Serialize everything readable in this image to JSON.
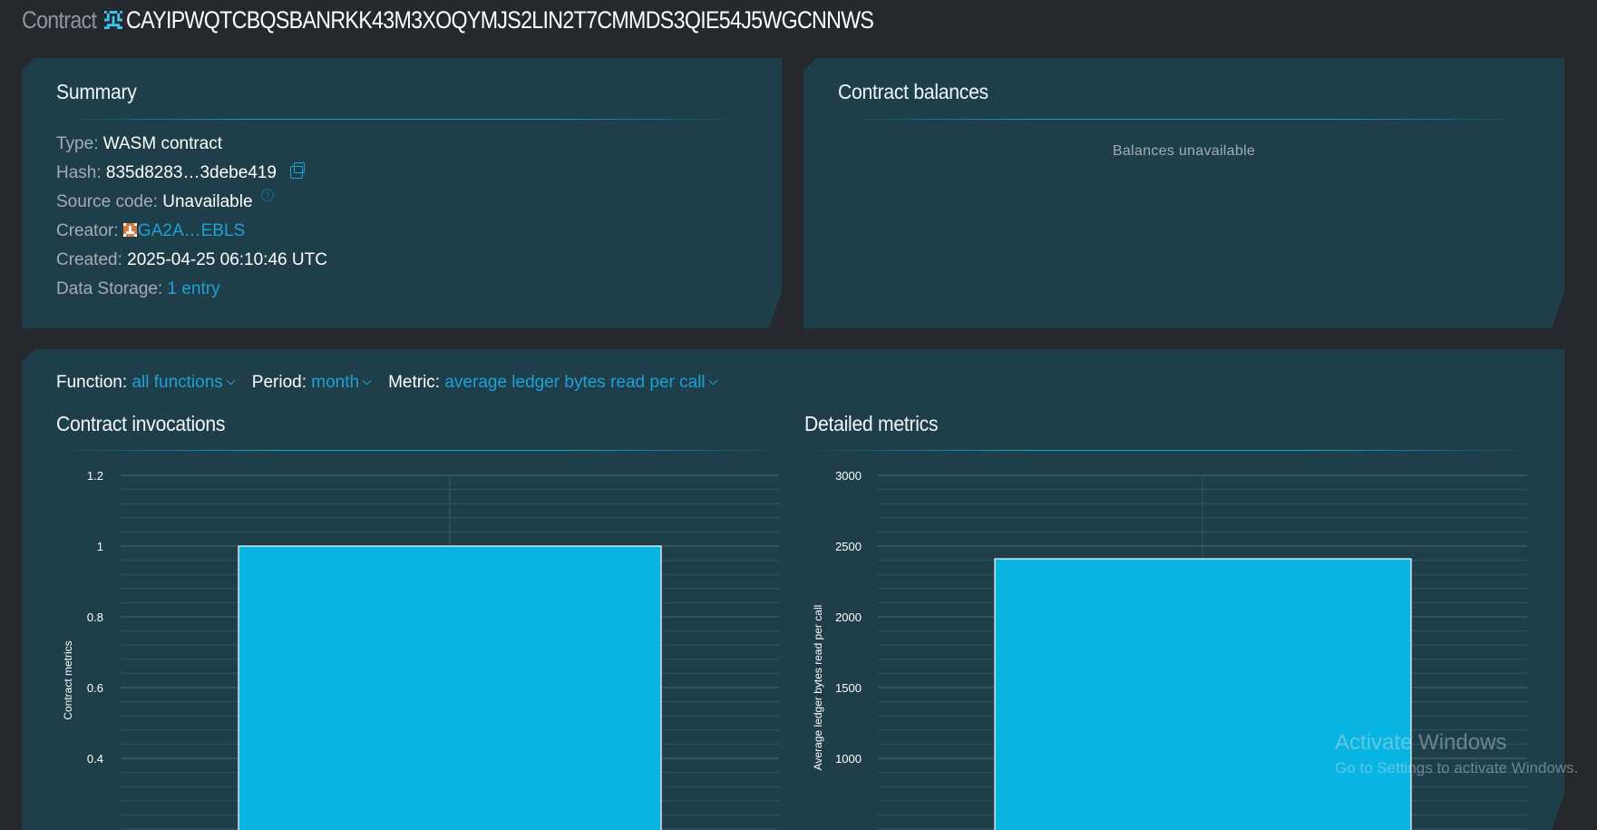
{
  "header": {
    "prefix": "Contract",
    "address": "CAYIPWQTCBQSBANRKK43M3XOQYMJS2LIN2T7CMMDS3QIE54J5WGCNNWS",
    "avatar_icon": "identicon-icon"
  },
  "summary": {
    "title": "Summary",
    "type_label": "Type:",
    "type_value": "WASM contract",
    "hash_label": "Hash:",
    "hash_value": "835d8283…3debe419",
    "source_label": "Source code:",
    "source_value": "Unavailable",
    "help_glyph": "?",
    "creator_label": "Creator:",
    "creator_value": "GA2A…EBLS",
    "created_label": "Created:",
    "created_value": "2025-04-25 06:10:46 UTC",
    "storage_label": "Data Storage:",
    "storage_value": "1 entry"
  },
  "balances": {
    "title": "Contract balances",
    "empty_text": "Balances unavailable"
  },
  "filters": {
    "function_label": "Function:",
    "function_value": "all functions",
    "period_label": "Period:",
    "period_value": "month",
    "metric_label": "Metric:",
    "metric_value": "average ledger bytes read per call"
  },
  "invocations": {
    "title": "Contract invocations"
  },
  "detailed": {
    "title": "Detailed metrics"
  },
  "colors": {
    "accent": "#1fa0d6",
    "bar": "#08b4e2",
    "panel": "#1e3f4a",
    "background": "#25292e"
  },
  "chart_data": [
    {
      "type": "bar",
      "title": "Contract invocations",
      "ylabel": "Contract metrics",
      "xlabel": "",
      "y_ticks": [
        "1.2",
        "1",
        "0.8",
        "0.6",
        "0.4"
      ],
      "ylim": [
        0,
        1.2
      ],
      "categories": [
        ""
      ],
      "values": [
        1
      ],
      "grid": true
    },
    {
      "type": "bar",
      "title": "Detailed metrics",
      "ylabel": "Average ledger bytes read per call",
      "xlabel": "",
      "y_ticks": [
        "3000",
        "2500",
        "2000",
        "1500",
        "1000"
      ],
      "ylim": [
        0,
        3000
      ],
      "categories": [
        ""
      ],
      "values": [
        2410
      ],
      "grid": true
    }
  ],
  "watermark": {
    "line1": "Activate Windows",
    "line2": "Go to Settings to activate Windows."
  }
}
